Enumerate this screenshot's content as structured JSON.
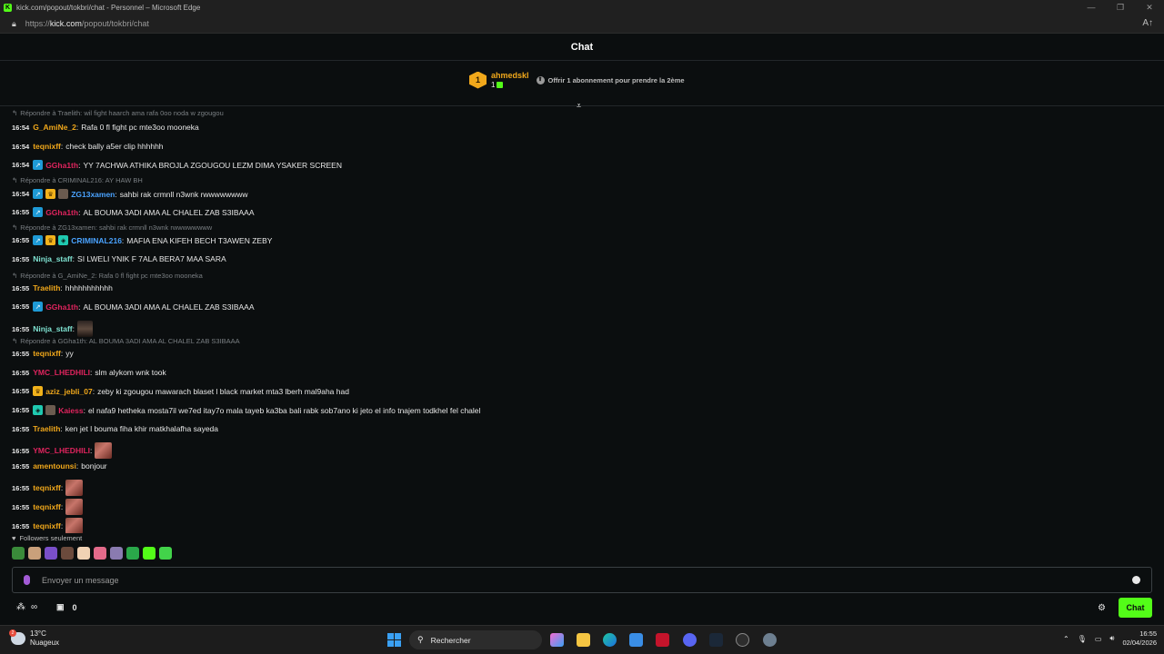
{
  "window": {
    "title": "kick.com/popout/tokbri/chat - Personnel – Microsoft Edge",
    "url_prefix": "https://",
    "url_host": "kick.com",
    "url_path": "/popout/tokbri/chat"
  },
  "chat": {
    "title": "Chat",
    "pinned": {
      "rank": "1",
      "username": "ahmedskl",
      "count": "1",
      "offer_text": "Offrir 1 abonnement pour prendre la 2ème"
    },
    "colors": {
      "accent": "#53fc18",
      "gold": "#f1a81b"
    },
    "messages": [
      {
        "kind": "reply",
        "text": "Répondre à Traelith: wil fight haarch ama rafa 0oo noda w zgougou"
      },
      {
        "kind": "msg",
        "time": "16:54",
        "user": "G_AmiNe_2",
        "color": "#f1a81b",
        "badges": [],
        "text": "Rafa 0 fl fight pc mte3oo mooneka"
      },
      {
        "kind": "msg",
        "time": "16:54",
        "user": "teqnixff",
        "color": "#f1a81b",
        "badges": [],
        "text": "check bally a5er clip hhhhhh"
      },
      {
        "kind": "msg",
        "time": "16:54",
        "user": "GGha1th",
        "color": "#e0245e",
        "badges": [
          "blue"
        ],
        "text": "YY 7ACHWA ATHIKA BROJLA ZGOUGOU LEZM DIMA YSAKER SCREEN"
      },
      {
        "kind": "reply",
        "text": "Répondre à CRIMINAL216: AY HAW BH"
      },
      {
        "kind": "msg",
        "time": "16:54",
        "user": "ZG13xamen",
        "color": "#4aa3ff",
        "badges": [
          "blue",
          "gold",
          "avatar"
        ],
        "text": "sahbi rak crmnll n3wnk rwwwwwwww"
      },
      {
        "kind": "msg",
        "time": "16:55",
        "user": "GGha1th",
        "color": "#e0245e",
        "badges": [
          "blue"
        ],
        "text": "AL BOUMA 3ADI AMA AL CHALEL ZAB S3IBAAA"
      },
      {
        "kind": "reply",
        "text": "Répondre à ZG13xamen: sahbi rak crmnll n3wnk rwwwwwwww"
      },
      {
        "kind": "msg",
        "time": "16:55",
        "user": "CRIMINAL216",
        "color": "#4aa3ff",
        "badges": [
          "blue",
          "gold",
          "teal"
        ],
        "text": "MAFIA ENA KIFEH BECH T3AWEN ZEBY"
      },
      {
        "kind": "msg",
        "time": "16:55",
        "user": "Ninja_staff",
        "color": "#7fe3d2",
        "badges": [],
        "text": "SI LWELI YNIK F 7ALA BERA7 MAA SARA"
      },
      {
        "kind": "reply",
        "text": "Répondre à G_AmiNe_2: Rafa 0 fl fight pc mte3oo mooneka"
      },
      {
        "kind": "msg",
        "time": "16:55",
        "user": "Traelith",
        "color": "#f1a81b",
        "badges": [],
        "text": "hhhhhhhhhhh"
      },
      {
        "kind": "msg",
        "time": "16:55",
        "user": "GGha1th",
        "color": "#e0245e",
        "badges": [
          "blue"
        ],
        "text": "AL BOUMA 3ADI AMA AL CHALEL ZAB S3IBAAA"
      },
      {
        "kind": "msg",
        "time": "16:55",
        "user": "Ninja_staff",
        "color": "#7fe3d2",
        "badges": [],
        "text": "",
        "emote": "person"
      },
      {
        "kind": "reply",
        "text": "Répondre à GGha1th: AL BOUMA 3ADI AMA AL CHALEL ZAB S3IBAAA"
      },
      {
        "kind": "msg",
        "time": "16:55",
        "user": "teqnixff",
        "color": "#f1a81b",
        "badges": [],
        "text": "yy"
      },
      {
        "kind": "msg",
        "time": "16:55",
        "user": "YMC_LHEDHILI",
        "color": "#e0245e",
        "badges": [],
        "text": "slm alykom wnk took"
      },
      {
        "kind": "msg",
        "time": "16:55",
        "user": "aziz_jebli_07",
        "color": "#f1a81b",
        "badges": [
          "gold"
        ],
        "text": "zeby ki zgougou mawarach blaset l black market mta3 lberh mal9aha had"
      },
      {
        "kind": "msg",
        "time": "16:55",
        "user": "Kaiess",
        "color": "#e0245e",
        "badges": [
          "teal",
          "avatar"
        ],
        "text": "el nafa9 hetheka mosta7il we7ed itay7o mala tayeb ka3ba bali rabk sob7ano ki jeto el info tnajem todkhel fel chalel"
      },
      {
        "kind": "msg",
        "time": "16:55",
        "user": "Traelith",
        "color": "#f1a81b",
        "badges": [],
        "text": "ken jet l bouma fiha khir matkhalafha sayeda"
      },
      {
        "kind": "msg",
        "time": "16:55",
        "user": "YMC_LHEDHILI",
        "color": "#e0245e",
        "badges": [],
        "text": "",
        "emote": "face"
      },
      {
        "kind": "msg",
        "time": "16:55",
        "user": "amentounsi",
        "color": "#f1a81b",
        "badges": [],
        "text": "bonjour"
      },
      {
        "kind": "msg",
        "time": "16:55",
        "user": "teqnixff",
        "color": "#f1a81b",
        "badges": [],
        "text": "",
        "emote": "face"
      },
      {
        "kind": "msg",
        "time": "16:55",
        "user": "teqnixff",
        "color": "#f1a81b",
        "badges": [],
        "text": "",
        "emote": "face"
      },
      {
        "kind": "msg",
        "time": "16:55",
        "user": "teqnixff",
        "color": "#f1a81b",
        "badges": [],
        "text": "",
        "emote": "face"
      }
    ],
    "followers_label": "Followers seulement",
    "input_placeholder": "Envoyer un message",
    "bottom": {
      "points": "0",
      "chat_button": "Chat"
    }
  },
  "taskbar": {
    "temperature": "13°C",
    "weather": "Nuageux",
    "weather_alert_count": "2",
    "search_placeholder": "Rechercher",
    "time": "16:55",
    "date": "02/04/2026"
  }
}
